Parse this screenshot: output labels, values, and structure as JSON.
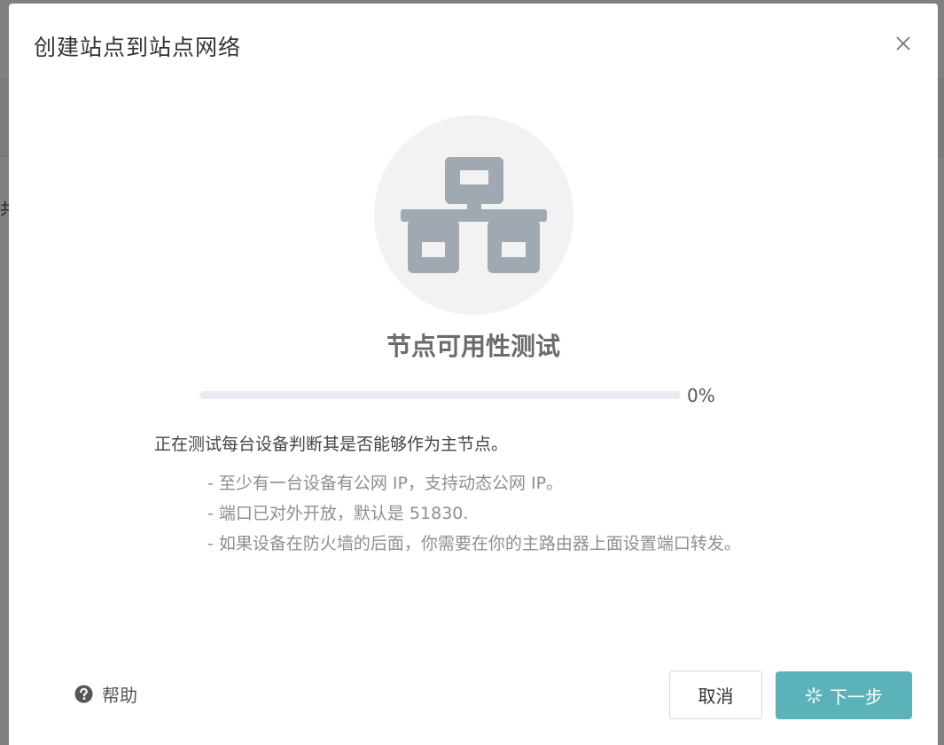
{
  "background": {
    "glyph": "共"
  },
  "dialog": {
    "title": "创建站点到站点网络",
    "close_icon": "close-icon"
  },
  "illustration": {
    "icon": "network-icon"
  },
  "step": {
    "title": "节点可用性测试",
    "progress_percent": 0,
    "progress_text": "0%",
    "description": "正在测试每台设备判断其是否能够作为主节点。",
    "requirements": [
      "- 至少有一台设备有公网 IP，支持动态公网 IP。",
      "- 端口已对外开放，默认是 51830.",
      "- 如果设备在防火墙的后面，你需要在你的主路由器上面设置端口转发。"
    ]
  },
  "footer": {
    "help_icon": "question-circle-icon",
    "help_label": "帮助",
    "cancel_label": "取消",
    "next_label": "下一步",
    "next_icon": "loading-spinner-icon"
  },
  "colors": {
    "primary": "#5cb2b9",
    "icon_gray": "#a0a8b2",
    "muted_text": "#8c8f99"
  }
}
